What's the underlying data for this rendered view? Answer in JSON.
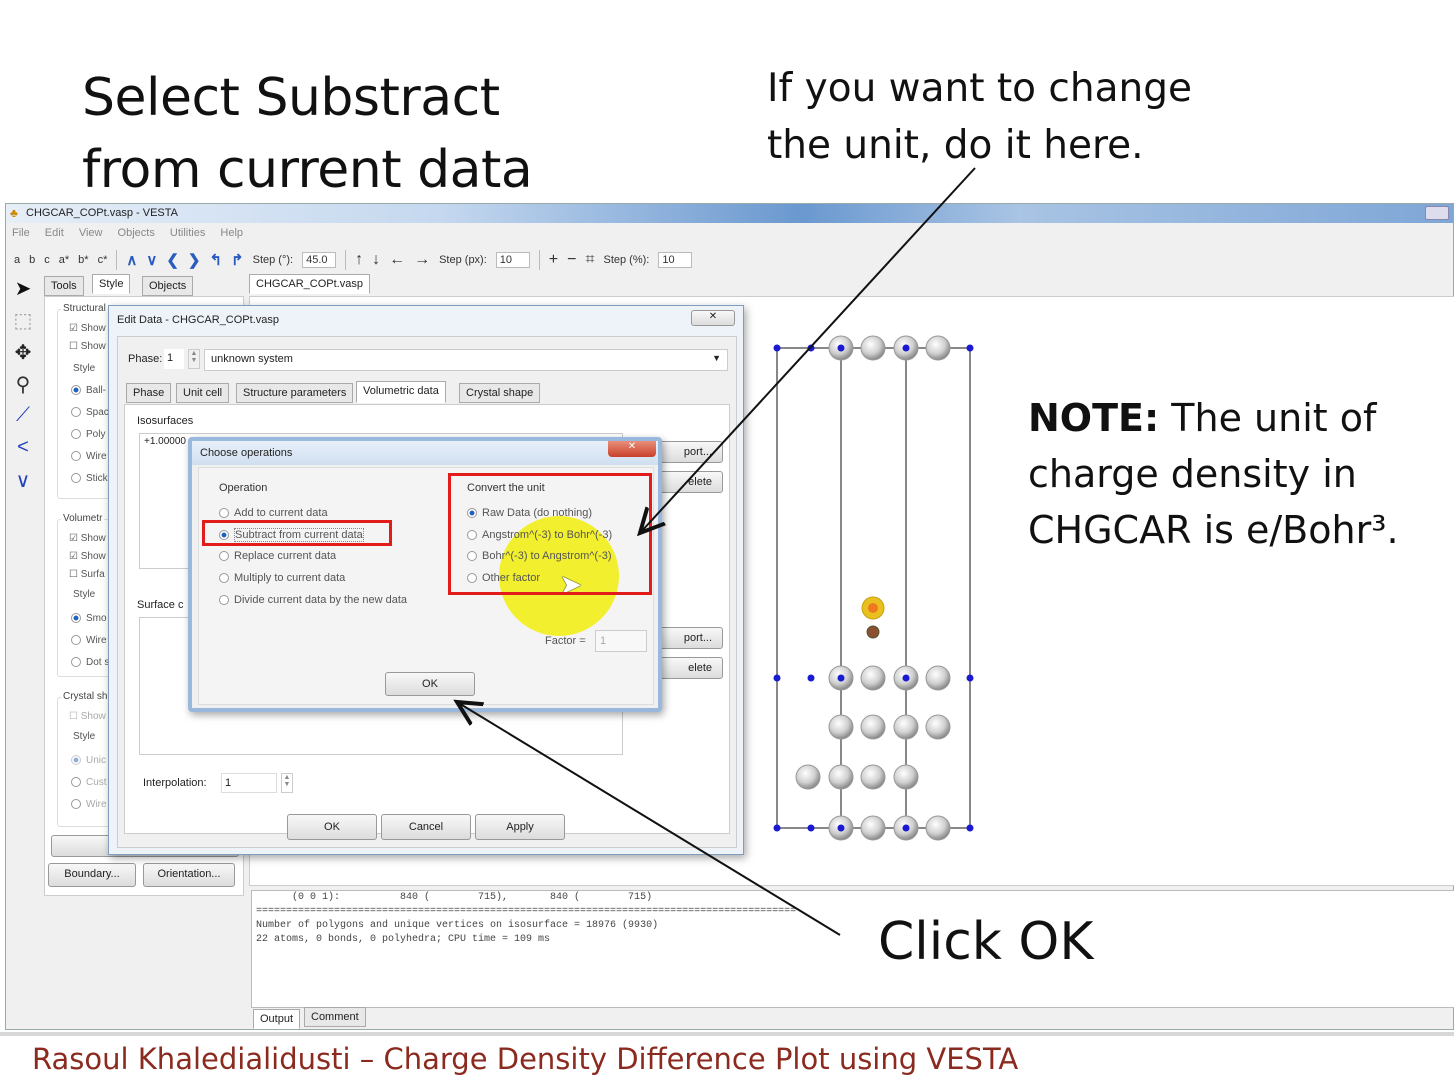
{
  "slide": {
    "title_lines": [
      "Select Substract",
      "from current data"
    ],
    "hint_lines": [
      "If you want to change",
      "the unit, do it here."
    ],
    "note_bold": "NOTE:",
    "note_lines": [
      " The unit of",
      "charge density in",
      "CHGCAR is e/Bohr³."
    ],
    "click_ok": "Click OK",
    "footer": "Rasoul Khaledialidusti – Charge Density Difference Plot using VESTA",
    "colors": {
      "footer": "#8b2a1f",
      "highlight_box": "#e21b1b",
      "cursor_highlight": "#f2ee1a"
    }
  },
  "window": {
    "title": "CHGCAR_COPt.vasp - VESTA",
    "menu": [
      "File",
      "Edit",
      "View",
      "Objects",
      "Utilities",
      "Help"
    ],
    "toolbar": {
      "axes": [
        "a",
        "b",
        "c",
        "a*",
        "b*",
        "c*"
      ],
      "rotate_step_label": "Step (°):",
      "rotate_step": "45.0",
      "pan_step_label": "Step (px):",
      "pan_step": "10",
      "zoom_step_label": "Step (%):",
      "zoom_step": "10"
    },
    "left_tabs": [
      "Tools",
      "Style",
      "Objects"
    ],
    "left_panel": {
      "structural_label": "Structural",
      "structural_opts": [
        "Show",
        "Show"
      ],
      "style_label": "Style",
      "style_opts": [
        "Ball-",
        "Spac",
        "Poly",
        "Wire",
        "Stick"
      ],
      "volumetric_label": "Volumetr",
      "volumetric_opts": [
        "Show",
        "Show",
        "Surfa"
      ],
      "vol_style_opts": [
        "Smo",
        "Wire",
        "Dot s"
      ],
      "crystal_label": "Crystal sh",
      "crystal_opts": [
        "Show"
      ],
      "crystal_style_opts": [
        "Unic",
        "Cust",
        "Wire"
      ],
      "boundary_button": "Boundary...",
      "orientation_button": "Orientation..."
    },
    "view_tab": "CHGCAR_COPt.vasp",
    "output_lines": [
      "      (0 0 1):          840 (        715),       840 (        715)",
      "==========================================================================================",
      "",
      "Number of polygons and unique vertices on isosurface = 18976 (9930)",
      "22 atoms, 0 bonds, 0 polyhedra; CPU time = 109 ms"
    ],
    "output_tabs": [
      "Output",
      "Comment"
    ]
  },
  "edit_data": {
    "title": "Edit Data - CHGCAR_COPt.vasp",
    "close": "✕",
    "phase_label": "Phase:",
    "phase_value": "1",
    "phase_name": "unknown system",
    "tabs": [
      "Phase",
      "Unit cell",
      "Structure parameters",
      "Volumetric data",
      "Crystal shape"
    ],
    "active_tab": "Volumetric data",
    "isosurfaces_label": "Isosurfaces",
    "isosurface_row": "+1.00000",
    "surface_label": "Surface c",
    "import_label": "port...",
    "delete_label": "elete",
    "interpolation_label": "Interpolation:",
    "interpolation_value": "1",
    "ok": "OK",
    "cancel": "Cancel",
    "apply": "Apply"
  },
  "choose_ops": {
    "title": "Choose operations",
    "close": "✕",
    "operation_label": "Operation",
    "operations": [
      "Add to current data",
      "Subtract from current data",
      "Replace current data",
      "Multiply to current data",
      "Divide current data by the new data"
    ],
    "selected_operation": "Subtract from current data",
    "convert_label": "Convert the unit",
    "conversions": [
      "Raw Data (do nothing)",
      "Angstrom^(-3) to Bohr^(-3)",
      "Bohr^(-3) to Angstrom^(-3)",
      "Other factor"
    ],
    "selected_conversion": "Raw Data (do nothing)",
    "factor_label": "Factor =",
    "factor_value": "1",
    "ok": "OK"
  }
}
